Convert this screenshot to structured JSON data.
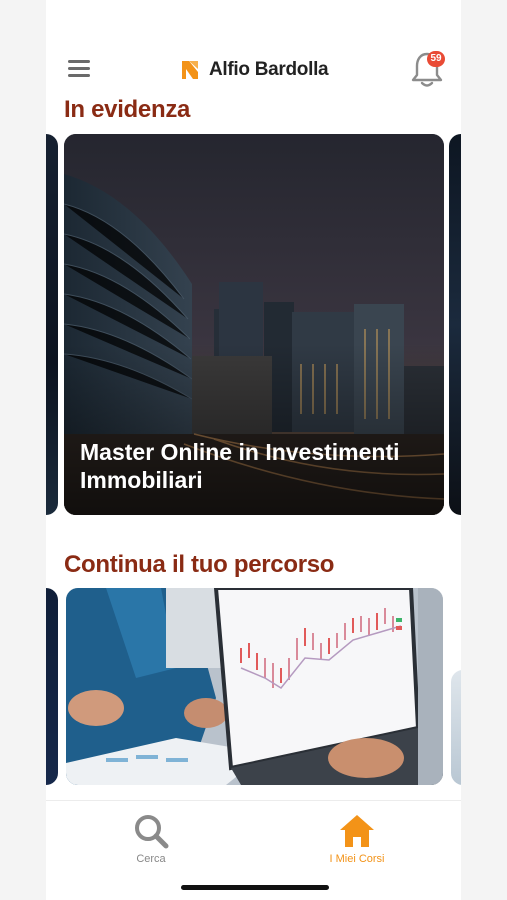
{
  "brand": {
    "name": "Alfio Bardolla",
    "accent": "#f39318"
  },
  "header": {
    "notification_count": "59"
  },
  "sections": {
    "featured": {
      "title": "In evidenza",
      "card_title": "Master Online in Investimenti Immobiliari"
    },
    "continue": {
      "title": "Continua il tuo percorso"
    }
  },
  "tabs": [
    {
      "label": "Cerca",
      "icon": "search-icon",
      "active": false
    },
    {
      "label": "I Miei Corsi",
      "icon": "home-icon",
      "active": true
    }
  ],
  "colors": {
    "section_title": "#8a2b14",
    "badge": "#e94b35",
    "active_tab": "#f39318"
  }
}
